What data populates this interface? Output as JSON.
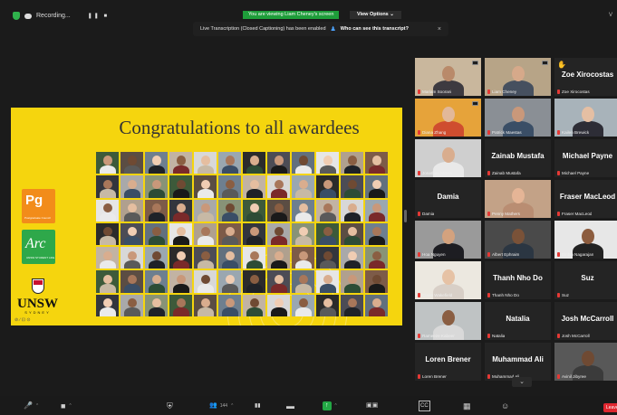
{
  "topbar": {
    "recording_label": "Recording...",
    "recording_controls": "❚❚ ■",
    "viewing_banner": "You are viewing Liam Cheney's screen",
    "view_options_label": "View Options ⌄",
    "caption_text": "Live Transcription (Closed Captioning) has been enabled",
    "caption_link": "Who can see this transcript?",
    "caption_close": "×",
    "view_toggle": "V"
  },
  "slide": {
    "title": "Congratulations to all awardees",
    "pg_logo": "Pg",
    "pg_sub": "Postgraduate Council",
    "arc_logo": "Arc",
    "arc_sub": "UNSW STUDENT LIFE",
    "unsw_logo": "UNSW",
    "unsw_sub": "SYDNEY",
    "annotation": "⊘ ∕ ⊡ ⊙"
  },
  "gallery": {
    "more_label": "⌄",
    "hand_icon": "✋",
    "tiles": [
      {
        "name": "Mariam Soorani",
        "video": true,
        "active": true,
        "pin": true,
        "skin": "#b98a6a",
        "shirt": "#3d3a40",
        "bg": "#c9b79d"
      },
      {
        "name": "Liam Cheney",
        "video": true,
        "active": true,
        "pin": true,
        "skin": "#d6a98a",
        "shirt": "#46505f",
        "bg": "#b7a487"
      },
      {
        "name": "Zoe Xirocostas",
        "big": "Zoe Xirocostas",
        "video": false,
        "hand": true
      },
      {
        "name": "Diana Zhang",
        "video": true,
        "active": true,
        "pin": true,
        "skin": "#e2b899",
        "shirt": "#cf4d2f",
        "bg": "#e6a33a"
      },
      {
        "name": "Patrick Maestas",
        "video": true,
        "skin": "#c9987a",
        "shirt": "#3a4e66",
        "bg": "#8a8f95"
      },
      {
        "name": "Kailen Brewick",
        "video": true,
        "skin": "#e5bfa3",
        "shirt": "#2d2d36",
        "bg": "#a8b3ba"
      },
      {
        "name": "Jonathan Morris",
        "video": true,
        "skin": "#d9ad8e",
        "shirt": "#e9e9e9",
        "bg": "#cfcfcf"
      },
      {
        "name": "Zainab Mustafa",
        "big": "Zainab Mustafa",
        "video": false
      },
      {
        "name": "Michael Payne",
        "big": "Michael Payne",
        "video": false
      },
      {
        "name": "Damia",
        "big": "Damia",
        "video": false
      },
      {
        "name": "Penny Mathers",
        "video": true,
        "skin": "#e5b596",
        "shirt": "#b98d72",
        "bg": "#c3a287"
      },
      {
        "name": "Fraser MacLeod",
        "big": "Fraser MacLeod",
        "video": false
      },
      {
        "name": "Hoa Nguyen",
        "video": true,
        "skin": "#d3a27e",
        "shirt": "#1d1d22",
        "bg": "#9a9a9a"
      },
      {
        "name": "Albert Ephraim",
        "video": true,
        "skin": "#7a5238",
        "shirt": "#2b3642",
        "bg": "#4a4a4a"
      },
      {
        "name": "Binbin Nagarajan",
        "video": true,
        "skin": "#8c5c3e",
        "shirt": "#222",
        "bg": "#e7e7e7"
      },
      {
        "name": "Claire Wakefield",
        "video": true,
        "skin": "#e6c2a5",
        "shirt": "#d8cfc7",
        "bg": "#ece8e0"
      },
      {
        "name": "Thanh Nho Do",
        "big": "Thanh Nho Do",
        "video": false
      },
      {
        "name": "Suz",
        "big": "Suz",
        "video": false
      },
      {
        "name": "Rameeze Kabeer",
        "video": true,
        "skin": "#8a5e42",
        "shirt": "#d9d9d9",
        "bg": "#bfc3c4"
      },
      {
        "name": "Natalia",
        "big": "Natalia",
        "video": false
      },
      {
        "name": "Josh McCarroll",
        "big": "Josh McCarroll",
        "video": false
      },
      {
        "name": "Loren Brener",
        "big": "Loren Brener",
        "video": false
      },
      {
        "name": "Muhammad Ali",
        "big": "Muhammad Ali",
        "video": false
      },
      {
        "name": "Avinil Jibyree",
        "video": true,
        "skin": "#6f4a33",
        "shirt": "#3b3b3b",
        "bg": "#585858"
      }
    ]
  },
  "toolbar": {
    "mute": "🎤",
    "mute_caret": "⌃",
    "video": "■",
    "video_caret": "⌃",
    "security": "⛨",
    "participants": "👥",
    "participants_count": "144",
    "participants_caret": "⌃",
    "polls": "▮▮",
    "chat": "▬",
    "share": "↑",
    "share_caret": "⌃",
    "record": "▣▣",
    "cc": "CC",
    "apps": "▦",
    "reactions": "☺",
    "leave": "Leave"
  },
  "collage": {
    "colors": [
      "#2b2b2b",
      "#d8d8d8",
      "#6e7f8f",
      "#3d5a3a",
      "#a9a9a9",
      "#7d5b48",
      "#e6e6e6",
      "#4c4c55",
      "#9aa7b0",
      "#c2b3a3",
      "#5b4d43",
      "#889377",
      "#33363d",
      "#b0a08e",
      "#62707e"
    ],
    "skins": [
      "#e5bea0",
      "#c9987a",
      "#8a5e42",
      "#d9ad8e",
      "#f0cdb3",
      "#a8775a",
      "#6f4a33"
    ],
    "shirts": [
      "#1f2228",
      "#3a4e66",
      "#eaeaea",
      "#7a2a2a",
      "#2d4c36",
      "#5a5a5a",
      "#c7b9a5",
      "#1a1a1a"
    ]
  }
}
